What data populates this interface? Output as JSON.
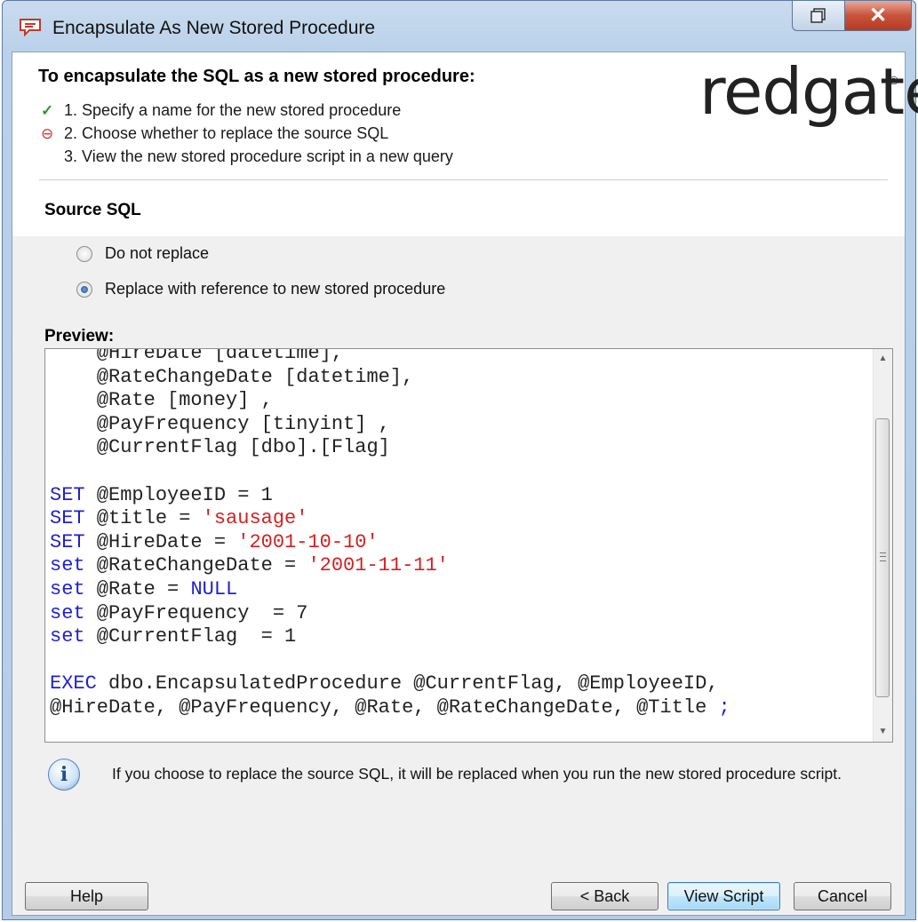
{
  "window": {
    "title": "Encapsulate As New Stored Procedure"
  },
  "header": {
    "title": "To encapsulate the SQL as a new stored procedure:",
    "steps": [
      {
        "text": "1. Specify a name for the new stored procedure",
        "state": "done"
      },
      {
        "text": "2. Choose whether to replace the source SQL",
        "state": "current"
      },
      {
        "text": "3. View the new stored procedure script in a new query",
        "state": "pending"
      }
    ],
    "logo": "redgate",
    "logo_mark": "®"
  },
  "source": {
    "title": "Source SQL",
    "options": [
      {
        "label": "Do not replace",
        "selected": false
      },
      {
        "label": "Replace with reference to new stored procedure",
        "selected": true
      }
    ]
  },
  "preview": {
    "label": "Preview:",
    "lines": [
      [
        {
          "t": "    @HireDate [datetime],",
          "k": "plain"
        }
      ],
      [
        {
          "t": "    @RateChangeDate [datetime],",
          "k": "plain"
        }
      ],
      [
        {
          "t": "    @Rate [money] ,",
          "k": "plain"
        }
      ],
      [
        {
          "t": "    @PayFrequency [tinyint] ,",
          "k": "plain"
        }
      ],
      [
        {
          "t": "    @CurrentFlag [dbo].[Flag]",
          "k": "plain"
        }
      ],
      [
        {
          "t": " ",
          "k": "plain"
        }
      ],
      [
        {
          "t": "SET",
          "k": "kw"
        },
        {
          "t": " @EmployeeID = 1",
          "k": "plain"
        }
      ],
      [
        {
          "t": "SET",
          "k": "kw"
        },
        {
          "t": " @title = ",
          "k": "plain"
        },
        {
          "t": "'sausage'",
          "k": "str"
        }
      ],
      [
        {
          "t": "SET",
          "k": "kw"
        },
        {
          "t": " @HireDate = ",
          "k": "plain"
        },
        {
          "t": "'2001-10-10'",
          "k": "str"
        }
      ],
      [
        {
          "t": "set",
          "k": "kw"
        },
        {
          "t": " @RateChangeDate = ",
          "k": "plain"
        },
        {
          "t": "'2001-11-11'",
          "k": "str"
        }
      ],
      [
        {
          "t": "set",
          "k": "kw"
        },
        {
          "t": " @Rate = ",
          "k": "plain"
        },
        {
          "t": "NULL",
          "k": "kw"
        }
      ],
      [
        {
          "t": "set",
          "k": "kw"
        },
        {
          "t": " @PayFrequency  = 7",
          "k": "plain"
        }
      ],
      [
        {
          "t": "set",
          "k": "kw"
        },
        {
          "t": " @CurrentFlag  = 1",
          "k": "plain"
        }
      ],
      [
        {
          "t": " ",
          "k": "plain"
        }
      ],
      [
        {
          "t": "EXEC",
          "k": "kw"
        },
        {
          "t": " dbo.EncapsulatedProcedure @CurrentFlag, @EmployeeID,",
          "k": "plain"
        }
      ],
      [
        {
          "t": "@HireDate, @PayFrequency, @Rate, @RateChangeDate, @Title ",
          "k": "plain"
        },
        {
          "t": ";",
          "k": "kw"
        }
      ]
    ]
  },
  "info": {
    "text": "If you choose to replace the source SQL, it will be replaced when you run the new stored procedure script."
  },
  "buttons": {
    "help": "Help",
    "back": "< Back",
    "view_script": "View Script",
    "cancel": "Cancel"
  }
}
